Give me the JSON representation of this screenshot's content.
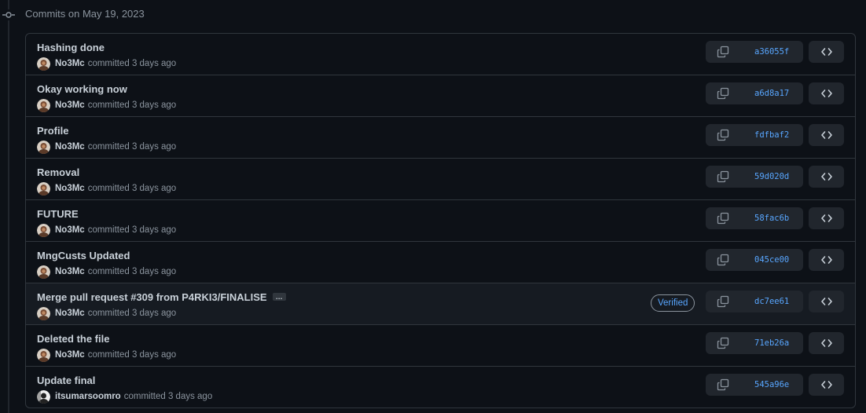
{
  "group": {
    "title": "Commits on May 19, 2023"
  },
  "colors": {
    "background": "#0d1117",
    "border": "#30363d",
    "link": "#58a6ff",
    "muted": "#8b949e",
    "button_bg": "#21262d"
  },
  "icons": {
    "timeline": "git-commit-icon",
    "copy": "copy-icon",
    "browse": "code-icon",
    "ellipsis": "ellipsis-icon"
  },
  "commits": [
    {
      "title": "Hashing done",
      "author": "No3Mc",
      "action": "committed 3 days ago",
      "sha": "a36055f",
      "verified": "",
      "has_more": false,
      "avatar": "photo"
    },
    {
      "title": "Okay working now",
      "author": "No3Mc",
      "action": "committed 3 days ago",
      "sha": "a6d8a17",
      "verified": "",
      "has_more": false,
      "avatar": "photo"
    },
    {
      "title": "Profile",
      "author": "No3Mc",
      "action": "committed 3 days ago",
      "sha": "fdfbaf2",
      "verified": "",
      "has_more": false,
      "avatar": "photo"
    },
    {
      "title": "Removal",
      "author": "No3Mc",
      "action": "committed 3 days ago",
      "sha": "59d020d",
      "verified": "",
      "has_more": false,
      "avatar": "photo"
    },
    {
      "title": "FUTURE",
      "author": "No3Mc",
      "action": "committed 3 days ago",
      "sha": "58fac6b",
      "verified": "",
      "has_more": false,
      "avatar": "photo"
    },
    {
      "title": "MngCusts Updated",
      "author": "No3Mc",
      "action": "committed 3 days ago",
      "sha": "045ce00",
      "verified": "",
      "has_more": false,
      "avatar": "photo"
    },
    {
      "title": "Merge pull request #309 from P4RKI3/FINALISE",
      "author": "No3Mc",
      "action": "committed 3 days ago",
      "sha": "dc7ee61",
      "verified": "Verified",
      "has_more": true,
      "more_label": "…",
      "avatar": "photo"
    },
    {
      "title": "Deleted the file",
      "author": "No3Mc",
      "action": "committed 3 days ago",
      "sha": "71eb26a",
      "verified": "",
      "has_more": false,
      "avatar": "photo"
    },
    {
      "title": "Update final",
      "author": "itsumarsoomro",
      "action": "committed 3 days ago",
      "sha": "545a96e",
      "verified": "",
      "has_more": false,
      "avatar": "bw"
    }
  ]
}
